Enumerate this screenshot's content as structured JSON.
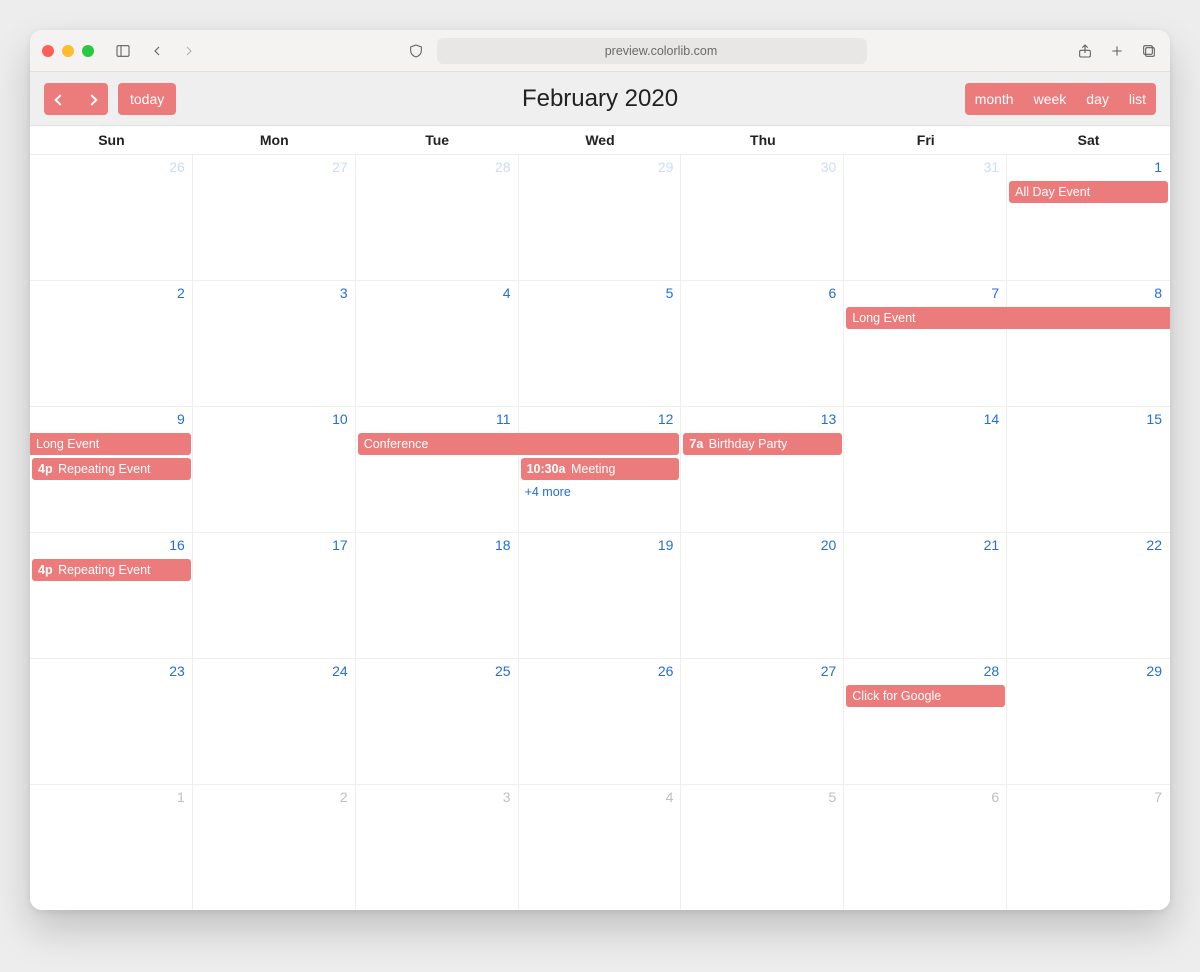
{
  "browser": {
    "url_text": "preview.colorlib.com"
  },
  "toolbar": {
    "today_label": "today",
    "title": "February 2020",
    "views": {
      "month": "month",
      "week": "week",
      "day": "day",
      "list": "list"
    }
  },
  "day_headers": [
    "Sun",
    "Mon",
    "Tue",
    "Wed",
    "Thu",
    "Fri",
    "Sat"
  ],
  "weeks": [
    {
      "days": [
        {
          "n": "26",
          "cls": "out"
        },
        {
          "n": "27",
          "cls": "out"
        },
        {
          "n": "28",
          "cls": "out"
        },
        {
          "n": "29",
          "cls": "out"
        },
        {
          "n": "30",
          "cls": "out"
        },
        {
          "n": "31",
          "cls": "out"
        },
        {
          "n": "1",
          "cls": "in"
        }
      ],
      "event_rows": [
        [
          {
            "col": 6,
            "span": 1,
            "title": "All Day Event"
          }
        ]
      ]
    },
    {
      "days": [
        {
          "n": "2",
          "cls": "in"
        },
        {
          "n": "3",
          "cls": "in"
        },
        {
          "n": "4",
          "cls": "in"
        },
        {
          "n": "5",
          "cls": "in"
        },
        {
          "n": "6",
          "cls": "in"
        },
        {
          "n": "7",
          "cls": "in"
        },
        {
          "n": "8",
          "cls": "in"
        }
      ],
      "event_rows": [
        [
          {
            "col": 5,
            "span": 2,
            "title": "Long Event",
            "edge": "start"
          }
        ]
      ]
    },
    {
      "days": [
        {
          "n": "9",
          "cls": "in"
        },
        {
          "n": "10",
          "cls": "in"
        },
        {
          "n": "11",
          "cls": "in"
        },
        {
          "n": "12",
          "cls": "in"
        },
        {
          "n": "13",
          "cls": "in"
        },
        {
          "n": "14",
          "cls": "in"
        },
        {
          "n": "15",
          "cls": "in"
        }
      ],
      "event_rows": [
        [
          {
            "col": 0,
            "span": 1,
            "title": "Long Event",
            "edge": "end"
          },
          {
            "col": 2,
            "span": 2,
            "title": "Conference"
          },
          {
            "col": 4,
            "span": 1,
            "time": "7a",
            "title": "Birthday Party"
          }
        ],
        [
          {
            "col": 0,
            "span": 1,
            "time": "4p",
            "title": "Repeating Event"
          },
          {
            "col": 3,
            "span": 1,
            "time": "10:30a",
            "title": "Meeting"
          }
        ]
      ],
      "more": {
        "col": 3,
        "text": "+4 more"
      }
    },
    {
      "days": [
        {
          "n": "16",
          "cls": "in"
        },
        {
          "n": "17",
          "cls": "in"
        },
        {
          "n": "18",
          "cls": "in"
        },
        {
          "n": "19",
          "cls": "in"
        },
        {
          "n": "20",
          "cls": "in"
        },
        {
          "n": "21",
          "cls": "in"
        },
        {
          "n": "22",
          "cls": "in"
        }
      ],
      "event_rows": [
        [
          {
            "col": 0,
            "span": 1,
            "time": "4p",
            "title": "Repeating Event"
          }
        ]
      ]
    },
    {
      "days": [
        {
          "n": "23",
          "cls": "in"
        },
        {
          "n": "24",
          "cls": "in"
        },
        {
          "n": "25",
          "cls": "in"
        },
        {
          "n": "26",
          "cls": "in"
        },
        {
          "n": "27",
          "cls": "in"
        },
        {
          "n": "28",
          "cls": "in"
        },
        {
          "n": "29",
          "cls": "in"
        }
      ],
      "event_rows": [
        [
          {
            "col": 5,
            "span": 1,
            "title": "Click for Google"
          }
        ]
      ]
    },
    {
      "days": [
        {
          "n": "1",
          "cls": "gray"
        },
        {
          "n": "2",
          "cls": "gray"
        },
        {
          "n": "3",
          "cls": "gray"
        },
        {
          "n": "4",
          "cls": "gray"
        },
        {
          "n": "5",
          "cls": "gray"
        },
        {
          "n": "6",
          "cls": "gray"
        },
        {
          "n": "7",
          "cls": "gray"
        }
      ],
      "event_rows": []
    }
  ]
}
